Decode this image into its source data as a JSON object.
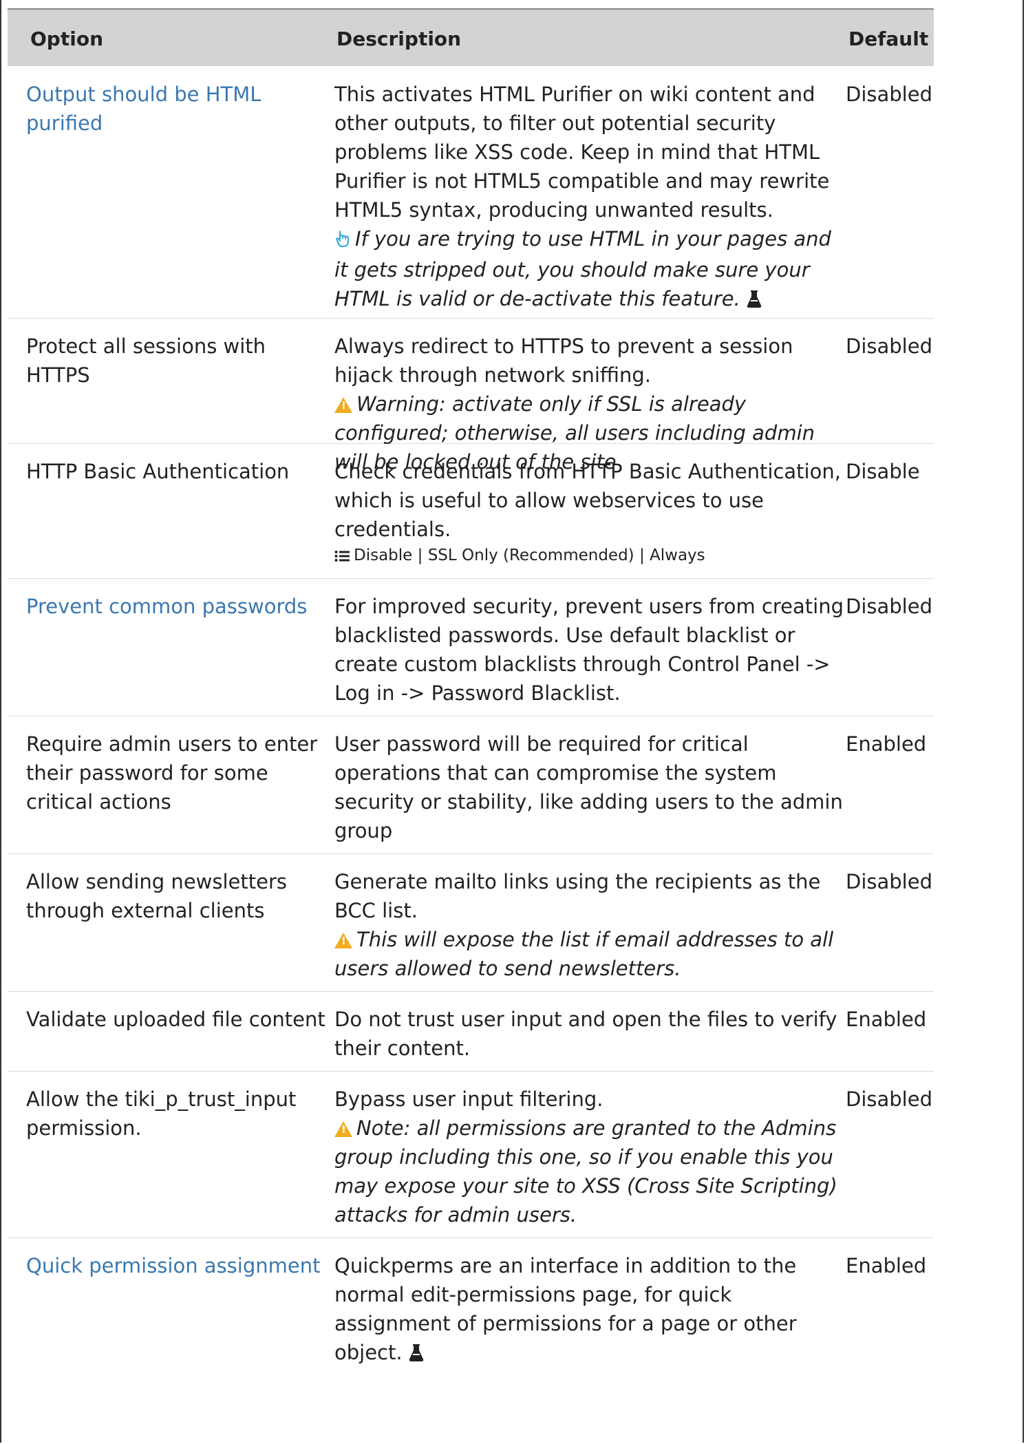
{
  "header": {
    "option": "Option",
    "description": "Description",
    "default": "Default"
  },
  "rows": [
    {
      "option": "Output should be HTML purified",
      "description": "This activates HTML Purifier on wiki content and other outputs, to filter out potential security problems like XSS code. Keep in mind that HTML Purifier is not HTML5 compatible and may rewrite HTML5 syntax, producing unwanted results.",
      "note": "If you are trying to use HTML in your pages and it gets stripped out, you should make sure your HTML is valid or de-activate this feature.",
      "default": "Disabled"
    },
    {
      "option": "Protect all sessions with HTTPS",
      "description": "Always redirect to HTTPS to prevent a session hijack through network sniffing.",
      "note": "Warning: activate only if SSL is already configured; otherwise, all users including admin will be locked out of the site",
      "default": "Disabled"
    },
    {
      "option": "HTTP Basic Authentication",
      "description": "Check credentials from HTTP Basic Authentication, which is useful to allow webservices to use credentials.",
      "options_line": "Disable | SSL Only (Recommended) | Always",
      "default": "Disable"
    },
    {
      "option": "Prevent common passwords",
      "description": "For improved security, prevent users from creating blacklisted passwords. Use default blacklist or create custom blacklists through Control Panel -> Log in -> Password Blacklist.",
      "default": "Disabled"
    },
    {
      "option": "Require admin users to enter their password for some critical actions",
      "description": "User password will be required for critical operations that can compromise the system security or stability, like adding users to the admin group",
      "default": "Enabled"
    },
    {
      "option": "Allow sending newsletters through external clients",
      "description": "Generate mailto links using the recipients as the BCC list.",
      "note": "This will expose the list if email addresses to all users allowed to send newsletters.",
      "default": "Disabled"
    },
    {
      "option": "Validate uploaded file content",
      "description": "Do not trust user input and open the files to verify their content.",
      "default": "Enabled"
    },
    {
      "option": "Allow the tiki_p_trust_input permission.",
      "description": "Bypass user input filtering.",
      "note": "Note: all permissions are granted to the Admins group including this one, so if you enable this you may expose your site to XSS (Cross Site Scripting) attacks for admin users.",
      "default": "Disabled"
    },
    {
      "option": "Quick permission assignment",
      "description": "Quickperms are an interface in addition to the normal edit-permissions page, for quick assignment of permissions for a page or other object.",
      "default": "Enabled"
    }
  ],
  "icons": {
    "tip": "pointing-hand-icon",
    "warning": "warning-triangle-icon",
    "experimental": "flask-icon",
    "list": "list-icon"
  },
  "colors": {
    "link": "#3a78b0",
    "warning": "#f0ad1e",
    "tip": "#2aa6d8",
    "header_bg": "#d3d3d3"
  }
}
